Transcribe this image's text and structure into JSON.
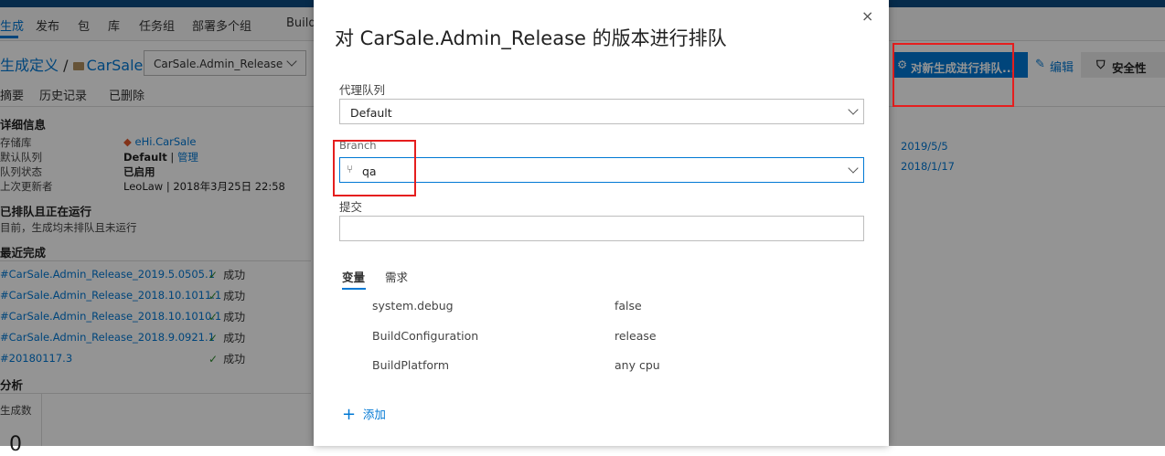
{
  "nav": {
    "items": [
      "生成",
      "发布",
      "包",
      "库",
      "任务组",
      "部署多个组",
      "Build"
    ]
  },
  "breadcrumb": {
    "root": "生成定义",
    "sep": "/",
    "folder": "CarSale",
    "definition": "CarSale.Admin_Release"
  },
  "tabs": [
    "摘要",
    "历史记录",
    "已删除"
  ],
  "details": {
    "heading": "详细信息",
    "rows": [
      {
        "label": "存储库",
        "value": "eHi.CarSale"
      },
      {
        "label": "默认队列",
        "value": "Default",
        "link": "管理"
      },
      {
        "label": "队列状态",
        "value": "已启用"
      },
      {
        "label": "上次更新者",
        "value": "LeoLaw | 2018年3月25日 22:58"
      }
    ]
  },
  "queued": {
    "heading": "已排队且正在运行",
    "text": "目前，生成均未排队且未运行"
  },
  "recent": {
    "heading": "最近完成",
    "items": [
      {
        "name": "#CarSale.Admin_Release_2019.5.0505.1",
        "status": "成功"
      },
      {
        "name": "#CarSale.Admin_Release_2018.10.1011.1",
        "status": "成功"
      },
      {
        "name": "#CarSale.Admin_Release_2018.10.1010.1",
        "status": "成功"
      },
      {
        "name": "#CarSale.Admin_Release_2018.9.0921.1",
        "status": "成功"
      },
      {
        "name": "#20180117.3",
        "status": "成功"
      }
    ]
  },
  "analysis": {
    "heading": "分析",
    "metric_label": "生成数",
    "metric_value": "0"
  },
  "right_dates": [
    "2019/5/5",
    "2018/1/17"
  ],
  "toolbar": {
    "queue_label": "对新生成进行排队...",
    "edit_label": "编辑",
    "security_label": "安全性"
  },
  "dialog": {
    "title": "对 CarSale.Admin_Release 的版本进行排队",
    "close": "×",
    "agent_queue_label": "代理队列",
    "agent_queue_value": "Default",
    "branch_label": "Branch",
    "branch_value": "qa",
    "commit_label": "提交",
    "commit_value": "",
    "tabs": [
      "变量",
      "需求"
    ],
    "variables": [
      {
        "name": "system.debug",
        "value": "false"
      },
      {
        "name": "BuildConfiguration",
        "value": "release"
      },
      {
        "name": "BuildPlatform",
        "value": "any cpu"
      }
    ],
    "add_label": "添加"
  },
  "colors": {
    "accent": "#0078d4",
    "success": "#2e8b2e",
    "highlight": "#e51e1e"
  }
}
